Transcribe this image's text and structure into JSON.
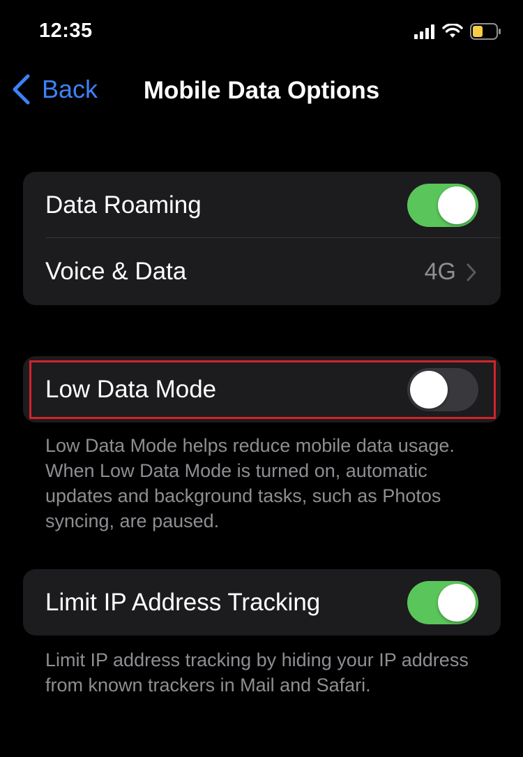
{
  "status": {
    "time": "12:35"
  },
  "nav": {
    "back_label": "Back",
    "title": "Mobile Data Options"
  },
  "group1": {
    "data_roaming": {
      "label": "Data Roaming",
      "enabled": true
    },
    "voice_data": {
      "label": "Voice & Data",
      "value": "4G"
    }
  },
  "low_data": {
    "label": "Low Data Mode",
    "enabled": false,
    "footer": "Low Data Mode helps reduce mobile data usage. When Low Data Mode is turned on, automatic updates and background tasks, such as Photos syncing, are paused."
  },
  "ip_tracking": {
    "label": "Limit IP Address Tracking",
    "enabled": true,
    "footer": "Limit IP address tracking by hiding your IP address from known trackers in Mail and Safari."
  },
  "colors": {
    "accent": "#3d82f5",
    "toggle_on": "#5ac55a",
    "highlight": "#d3232b"
  }
}
